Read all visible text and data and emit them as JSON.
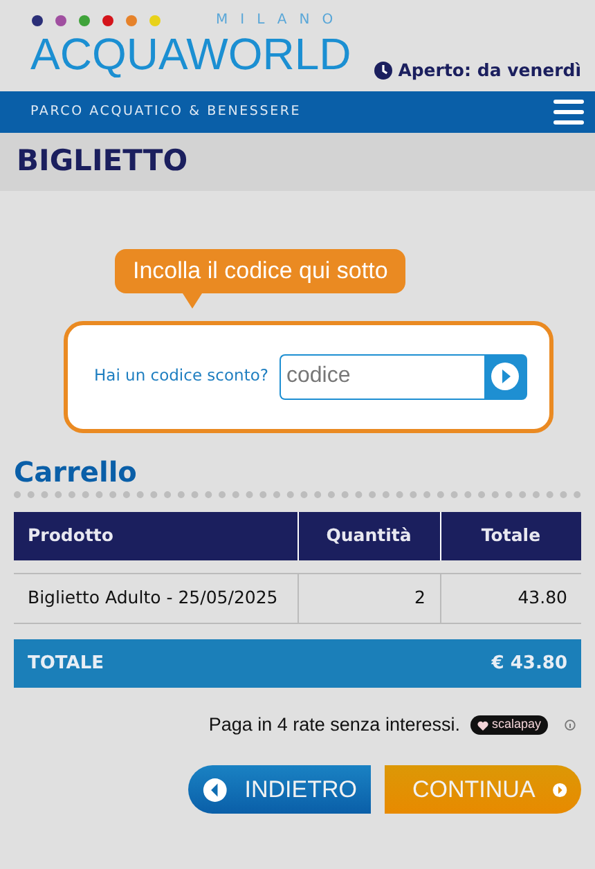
{
  "header": {
    "logo_top": "MILANO",
    "logo": "ACQUAWORLD",
    "opening": "Aperto: da venerdì",
    "tagline": "PARCO ACQUATICO & BENESSERE"
  },
  "page_title": "BIGLIETTO",
  "coupon": {
    "tooltip": "Incolla il codice qui sotto",
    "label": "Hai un codice sconto?",
    "placeholder": "codice"
  },
  "cart": {
    "title": "Carrello",
    "columns": [
      "Prodotto",
      "Quantità",
      "Totale"
    ],
    "rows": [
      [
        "Biglietto Adulto - 25/05/2025",
        "2",
        "43.80"
      ]
    ],
    "total_label": "TOTALE",
    "total_value": "€ 43.80"
  },
  "installments": {
    "text": "Paga in 4 rate senza interessi.",
    "badge": "scalapay"
  },
  "buttons": [
    {
      "label": "INDIETRO",
      "kind": "back"
    },
    {
      "label": "CONTINUA",
      "kind": "next"
    }
  ]
}
